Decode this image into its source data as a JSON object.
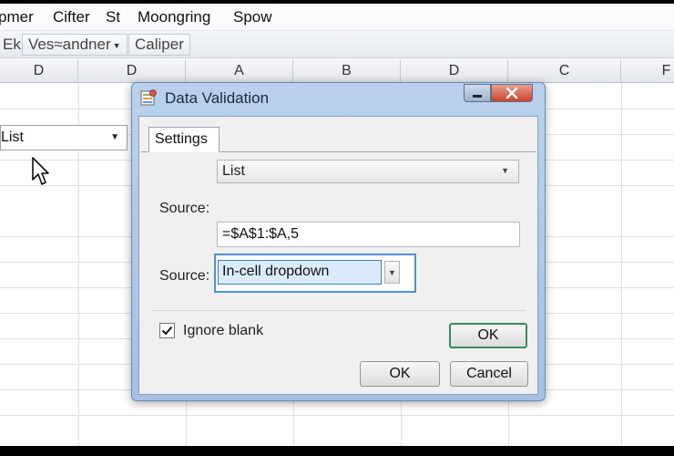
{
  "menubar": {
    "items": [
      "pmer",
      "Cifter",
      "St",
      "Moongring",
      "Spow"
    ]
  },
  "toolbar": {
    "items": [
      "Ek",
      "Ves≈andner",
      "Caliper"
    ]
  },
  "column_headers": [
    "D",
    "D",
    "A",
    "B",
    "D",
    "C",
    "F"
  ],
  "sheet": {
    "cell_dropdown_value": "List"
  },
  "dialog": {
    "title": "Data Validation",
    "tab_settings": "Settings",
    "allow_value": "List",
    "source_label": "Source:",
    "source_value": "=$A$1:$A,5",
    "dropdown_label": "Source:",
    "dropdown_value": "In-cell dropdown",
    "ignore_blank_label": "Ignore blank",
    "ignore_blank_checked": true,
    "ok_primary": "OK",
    "ok_label": "OK",
    "cancel_label": "Cancel"
  },
  "colors": {
    "dialog_frame": "#a6c1e2",
    "focus_border": "#4d90d4",
    "default_button_border": "#3b8a5d",
    "close_button": "#c9442e"
  }
}
